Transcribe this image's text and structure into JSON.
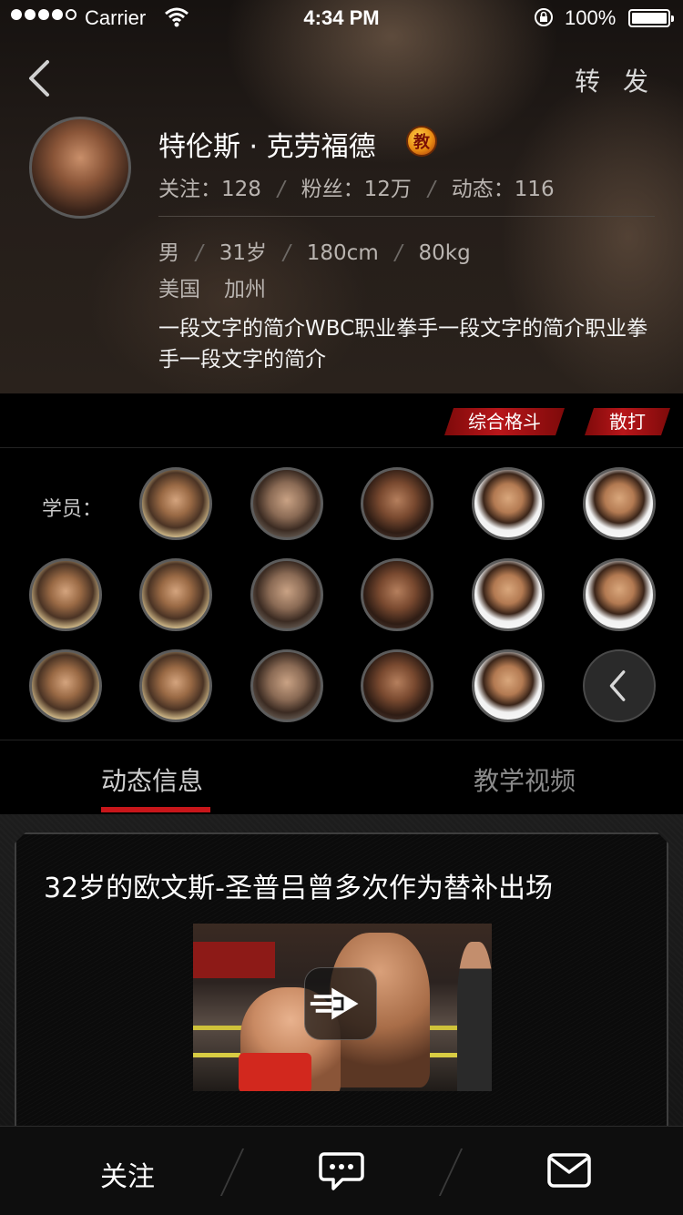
{
  "status_bar": {
    "carrier": "Carrier",
    "time": "4:34 PM",
    "battery": "100%",
    "battery_level": 1.0,
    "signal_bars_filled": 4,
    "signal_bars_total": 5
  },
  "header": {
    "back_icon": "chevron-left-icon",
    "share_label": "转 发"
  },
  "profile": {
    "name": "特伦斯 · 克劳福德",
    "badge": "教",
    "following_label": "关注：128",
    "fans_label": "粉丝：12万",
    "posts_label": "动态：116",
    "gender": "男",
    "age": "31岁",
    "height": "180cm",
    "weight": "80kg",
    "country": "美国",
    "region": "加州",
    "bio": "一段文字的简介WBC职业拳手一段文字的简介职业拳手一段文字的简介"
  },
  "tags": [
    "综合格斗",
    "散打"
  ],
  "students": {
    "label": "学员：",
    "avatars": [
      "rdj",
      "tc",
      "fighter",
      "asian",
      "asian",
      "rdj",
      "rdj",
      "tc",
      "fighter",
      "asian",
      "asian",
      "rdj",
      "rdj",
      "tc",
      "fighter",
      "asian"
    ],
    "more_icon": "chevron-left-icon"
  },
  "tabs": {
    "active": "动态信息",
    "inactive": "教学视频"
  },
  "feed": {
    "post_title": "32岁的欧文斯-圣普吕曾多次作为替补出场",
    "play_icon": "video-play-icon"
  },
  "bottom_bar": {
    "follow_label": "关注",
    "chat_icon": "chat-bubble-icon",
    "mail_icon": "envelope-icon"
  },
  "colors": {
    "accent_red": "#c8161a",
    "tag_red": "#b8161a",
    "badge_orange": "#e88a12"
  }
}
